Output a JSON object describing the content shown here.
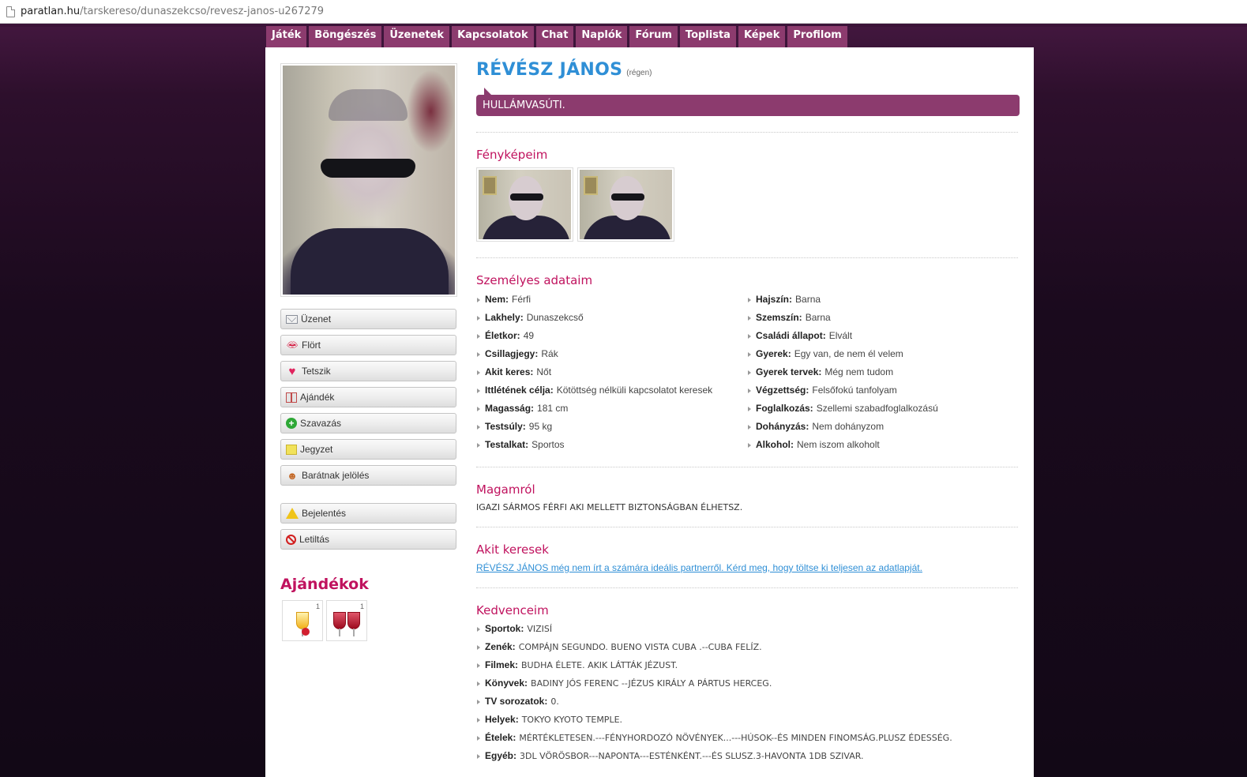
{
  "browser": {
    "url_host": "paratlan.hu",
    "url_path": "/tarskereso/dunaszekcso/revesz-janos-u267279"
  },
  "nav": [
    "Játék",
    "Böngészés",
    "Üzenetek",
    "Kapcsolatok",
    "Chat",
    "Naplók",
    "Fórum",
    "Toplista",
    "Képek",
    "Profilom"
  ],
  "profile": {
    "name": "RÉVÉSZ JÁNOS",
    "last_seen": "(régen)",
    "status": "HULLÁMVASÚTI."
  },
  "actions": {
    "message": "Üzenet",
    "flirt": "Flört",
    "like": "Tetszik",
    "gift": "Ajándék",
    "vote": "Szavazás",
    "note": "Jegyzet",
    "friend": "Barátnak jelölés",
    "report": "Bejelentés",
    "block": "Letiltás"
  },
  "gifts": {
    "title": "Ajándékok",
    "items": [
      {
        "count": "1"
      },
      {
        "count": "1"
      }
    ]
  },
  "photos": {
    "title": "Fényképeim"
  },
  "personal": {
    "title": "Személyes adataim",
    "left": [
      {
        "label": "Nem:",
        "value": "Férfi"
      },
      {
        "label": "Lakhely:",
        "value": "Dunaszekcső"
      },
      {
        "label": "Életkor:",
        "value": "49"
      },
      {
        "label": "Csillagjegy:",
        "value": "Rák"
      },
      {
        "label": "Akit keres:",
        "value": "Nőt"
      },
      {
        "label": "Ittlétének célja:",
        "value": "Kötöttség nélküli kapcsolatot keresek"
      },
      {
        "label": "Magasság:",
        "value": "181 cm"
      },
      {
        "label": "Testsúly:",
        "value": "95 kg"
      },
      {
        "label": "Testalkat:",
        "value": "Sportos"
      }
    ],
    "right": [
      {
        "label": "Hajszín:",
        "value": "Barna"
      },
      {
        "label": "Szemszín:",
        "value": "Barna"
      },
      {
        "label": "Családi állapot:",
        "value": "Elvált"
      },
      {
        "label": "Gyerek:",
        "value": "Egy van, de nem él velem"
      },
      {
        "label": "Gyerek tervek:",
        "value": "Még nem tudom"
      },
      {
        "label": "Végzettség:",
        "value": "Felsőfokú tanfolyam"
      },
      {
        "label": "Foglalkozás:",
        "value": "Szellemi szabadfoglalkozású"
      },
      {
        "label": "Dohányzás:",
        "value": "Nem dohányzom"
      },
      {
        "label": "Alkohol:",
        "value": "Nem iszom alkoholt"
      }
    ]
  },
  "about": {
    "title": "Magamról",
    "text": "IGAZI SÁRMOS FÉRFI AKI MELLETT BIZTONSÁGBAN ÉLHETSZ."
  },
  "seeking": {
    "title": "Akit keresek",
    "text": "RÉVÉSZ JÁNOS még nem írt a számára ideális partnerről. Kérd meg, hogy töltse ki teljesen az adatlapját."
  },
  "favorites": {
    "title": "Kedvenceim",
    "items": [
      {
        "label": "Sportok:",
        "value": "VIZISÍ"
      },
      {
        "label": "Zenék:",
        "value": "COMPÁJN SEGUNDO. BUENO VISTA CUBA .--CUBA FELÍZ."
      },
      {
        "label": "Filmek:",
        "value": "BUDHA ÉLETE. AKIK LÁTTÁK JÉZUST."
      },
      {
        "label": "Könyvek:",
        "value": "BADINY JÓS FERENC --JÉZUS KIRÁLY A PÁRTUS HERCEG."
      },
      {
        "label": "TV sorozatok:",
        "value": "0."
      },
      {
        "label": "Helyek:",
        "value": "TOKYO KYOTO TEMPLE."
      },
      {
        "label": "Ételek:",
        "value": "MÉRTÉKLETESEN.---FÉNYHORDOZÓ NÖVÉNYEK...---HÚSOK--ÉS MINDEN FINOMSÁG.PLUSZ ÉDESSÉG."
      },
      {
        "label": "Egyéb:",
        "value": "3DL VÖRÖSBOR---NAPONTA---ESTÉNKÉNT.---ÉS SLUSZ.3-HAVONTA 1DB SZIVAR."
      }
    ]
  }
}
